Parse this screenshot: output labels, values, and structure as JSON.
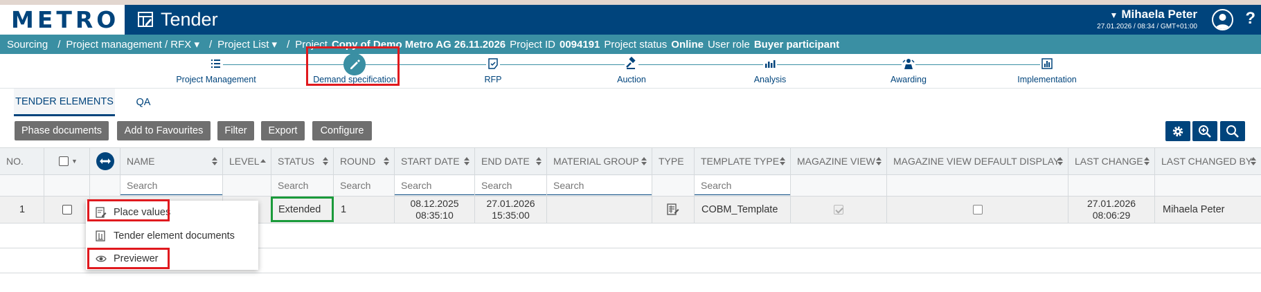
{
  "header": {
    "logo": "METRO",
    "app_title": "Tender",
    "user_name": "Mihaela Peter",
    "user_time": "27.01.2026 / 08:34 / GMT+01:00",
    "help": "?"
  },
  "breadcrumb": {
    "sourcing": "Sourcing",
    "project_mgmt": "Project management / RFX",
    "project_list": "Project List",
    "project_label": "Project",
    "project_name": "Copy of Demo Metro AG 26.11.2026",
    "project_id_label": "Project ID",
    "project_id": "0094191",
    "status_label": "Project status",
    "status": "Online",
    "role_label": "User role",
    "role": "Buyer participant"
  },
  "stepper": {
    "steps": [
      {
        "label": "Project Management",
        "icon": "list-icon"
      },
      {
        "label": "Demand specification",
        "icon": "pencil-icon"
      },
      {
        "label": "RFP",
        "icon": "document-check-icon"
      },
      {
        "label": "Auction",
        "icon": "gavel-icon"
      },
      {
        "label": "Analysis",
        "icon": "bar-chart-icon"
      },
      {
        "label": "Awarding",
        "icon": "award-icon"
      },
      {
        "label": "Implementation",
        "icon": "chart-box-icon"
      }
    ],
    "active_index": 1
  },
  "tabs": [
    {
      "label": "TENDER ELEMENTS"
    },
    {
      "label": "QA"
    }
  ],
  "toolbar": {
    "phase_documents": "Phase documents",
    "add_favourites": "Add to Favourites",
    "filter": "Filter",
    "export": "Export",
    "configure": "Configure"
  },
  "grid": {
    "columns": {
      "no": "NO.",
      "name": "NAME",
      "level": "LEVEL",
      "status": "STATUS",
      "round": "ROUND",
      "start_date": "START DATE",
      "end_date": "END DATE",
      "material_group": "MATERIAL GROUP",
      "type": "TYPE",
      "template_type": "TEMPLATE TYPE",
      "magazine_view": "MAGAZINE VIEW",
      "magazine_default": "MAGAZINE VIEW DEFAULT DISPLAY",
      "last_change": "LAST CHANGE",
      "last_changed_by": "LAST CHANGED BY"
    },
    "search_placeholder": "Search",
    "rows": [
      {
        "no": "1",
        "status": "Extended",
        "round": "1",
        "start_date": "08.12.2025",
        "start_time": "08:35:10",
        "end_date": "27.01.2026",
        "end_time": "15:35:00",
        "template_type": "COBM_Template",
        "magazine_view_checked": true,
        "magazine_default_checked": false,
        "last_change_date": "27.01.2026",
        "last_change_time": "08:06:29",
        "last_changed_by": "Mihaela Peter"
      }
    ]
  },
  "context_menu": {
    "place_values": "Place values",
    "tender_element_documents": "Tender element documents",
    "previewer": "Previewer"
  },
  "colors": {
    "header": "#00447c",
    "breadcrumb": "#3a8fa3",
    "highlight_red": "#e0191e",
    "highlight_green": "#1a9a3a"
  }
}
